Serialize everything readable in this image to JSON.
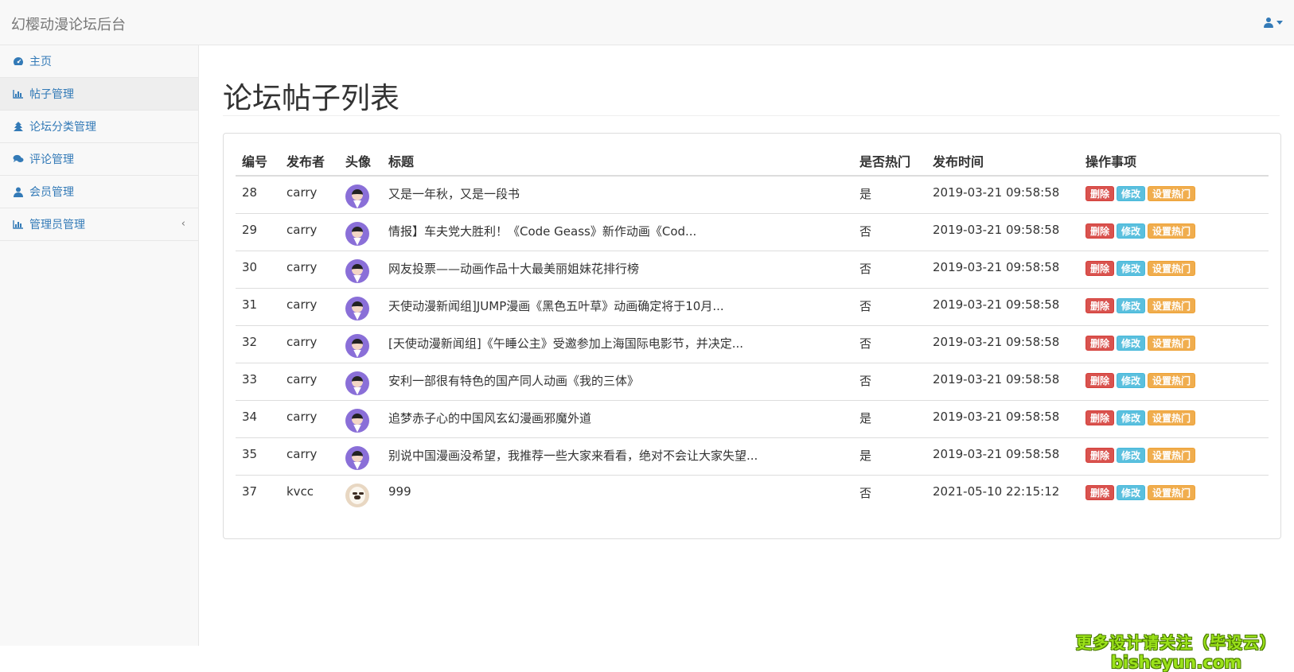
{
  "navbar": {
    "brand": "幻樱动漫论坛后台"
  },
  "sidebar": {
    "items": [
      {
        "label": "主页",
        "icon": "dashboard-icon"
      },
      {
        "label": "帖子管理",
        "icon": "bar-chart-icon"
      },
      {
        "label": "论坛分类管理",
        "icon": "tree-icon"
      },
      {
        "label": "评论管理",
        "icon": "comments-icon"
      },
      {
        "label": "会员管理",
        "icon": "user-icon"
      },
      {
        "label": "管理员管理",
        "icon": "bar-chart-icon",
        "arrow": "‹"
      }
    ]
  },
  "main": {
    "title": "论坛帖子列表",
    "table": {
      "headers": [
        "编号",
        "发布者",
        "头像",
        "标题",
        "是否热门",
        "发布时间",
        "操作事项"
      ],
      "rows": [
        {
          "id": "28",
          "author": "carry",
          "avatar": "purple",
          "title": "又是一年秋，又是一段书",
          "hot": "是",
          "time": "2019-03-21 09:58:58"
        },
        {
          "id": "29",
          "author": "carry",
          "avatar": "purple",
          "title": "情报】车夫党大胜利！《Code Geass》新作动画《Cod...",
          "hot": "否",
          "time": "2019-03-21 09:58:58"
        },
        {
          "id": "30",
          "author": "carry",
          "avatar": "purple",
          "title": "网友投票——动画作品十大最美丽姐妹花排行榜",
          "hot": "否",
          "time": "2019-03-21 09:58:58"
        },
        {
          "id": "31",
          "author": "carry",
          "avatar": "purple",
          "title": "天使动漫新闻组]JUMP漫画《黑色五叶草》动画确定将于10月...",
          "hot": "否",
          "time": "2019-03-21 09:58:58"
        },
        {
          "id": "32",
          "author": "carry",
          "avatar": "purple",
          "title": "[天使动漫新闻组]《午睡公主》受邀参加上海国际电影节，并决定...",
          "hot": "否",
          "time": "2019-03-21 09:58:58"
        },
        {
          "id": "33",
          "author": "carry",
          "avatar": "purple",
          "title": "安利一部很有特色的国产同人动画《我的三体》",
          "hot": "否",
          "time": "2019-03-21 09:58:58"
        },
        {
          "id": "34",
          "author": "carry",
          "avatar": "purple",
          "title": "追梦赤子心的中国风玄幻漫画邪魔外道",
          "hot": "是",
          "time": "2019-03-21 09:58:58"
        },
        {
          "id": "35",
          "author": "carry",
          "avatar": "purple",
          "title": "别说中国漫画没希望，我推荐一些大家来看看，绝对不会让大家失望...",
          "hot": "是",
          "time": "2019-03-21 09:58:58"
        },
        {
          "id": "37",
          "author": "kvcc",
          "avatar": "dog",
          "title": "999",
          "hot": "否",
          "time": "2021-05-10 22:15:12"
        }
      ],
      "actions": {
        "delete": "删除",
        "edit": "修改",
        "set_hot": "设置热门"
      }
    }
  },
  "watermark": {
    "line1": "更多设计请关注（毕设云）",
    "line2": "bisheyun.com"
  },
  "colors": {
    "link": "#337ab7",
    "danger": "#d9534f",
    "info": "#5bc0de",
    "warning": "#f0ad4e"
  }
}
